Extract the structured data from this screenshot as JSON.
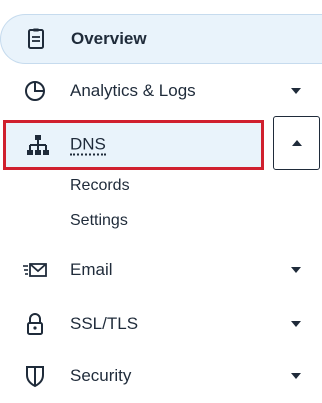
{
  "nav": {
    "overview": {
      "label": "Overview",
      "icon": "document-icon"
    },
    "analytics": {
      "label": "Analytics & Logs",
      "icon": "pie-chart-icon"
    },
    "dns": {
      "label": "DNS",
      "icon": "network-icon",
      "expanded": true,
      "highlight_color": "#d0202e",
      "subitems": [
        {
          "label": "Records"
        },
        {
          "label": "Settings"
        }
      ]
    },
    "email": {
      "label": "Email",
      "icon": "email-icon"
    },
    "ssl": {
      "label": "SSL/TLS",
      "icon": "lock-icon"
    },
    "security": {
      "label": "Security",
      "icon": "shield-icon"
    }
  },
  "colors": {
    "active_background": "#e9f3fb",
    "text": "#1f2b3a",
    "highlight_border": "#d0202e"
  }
}
